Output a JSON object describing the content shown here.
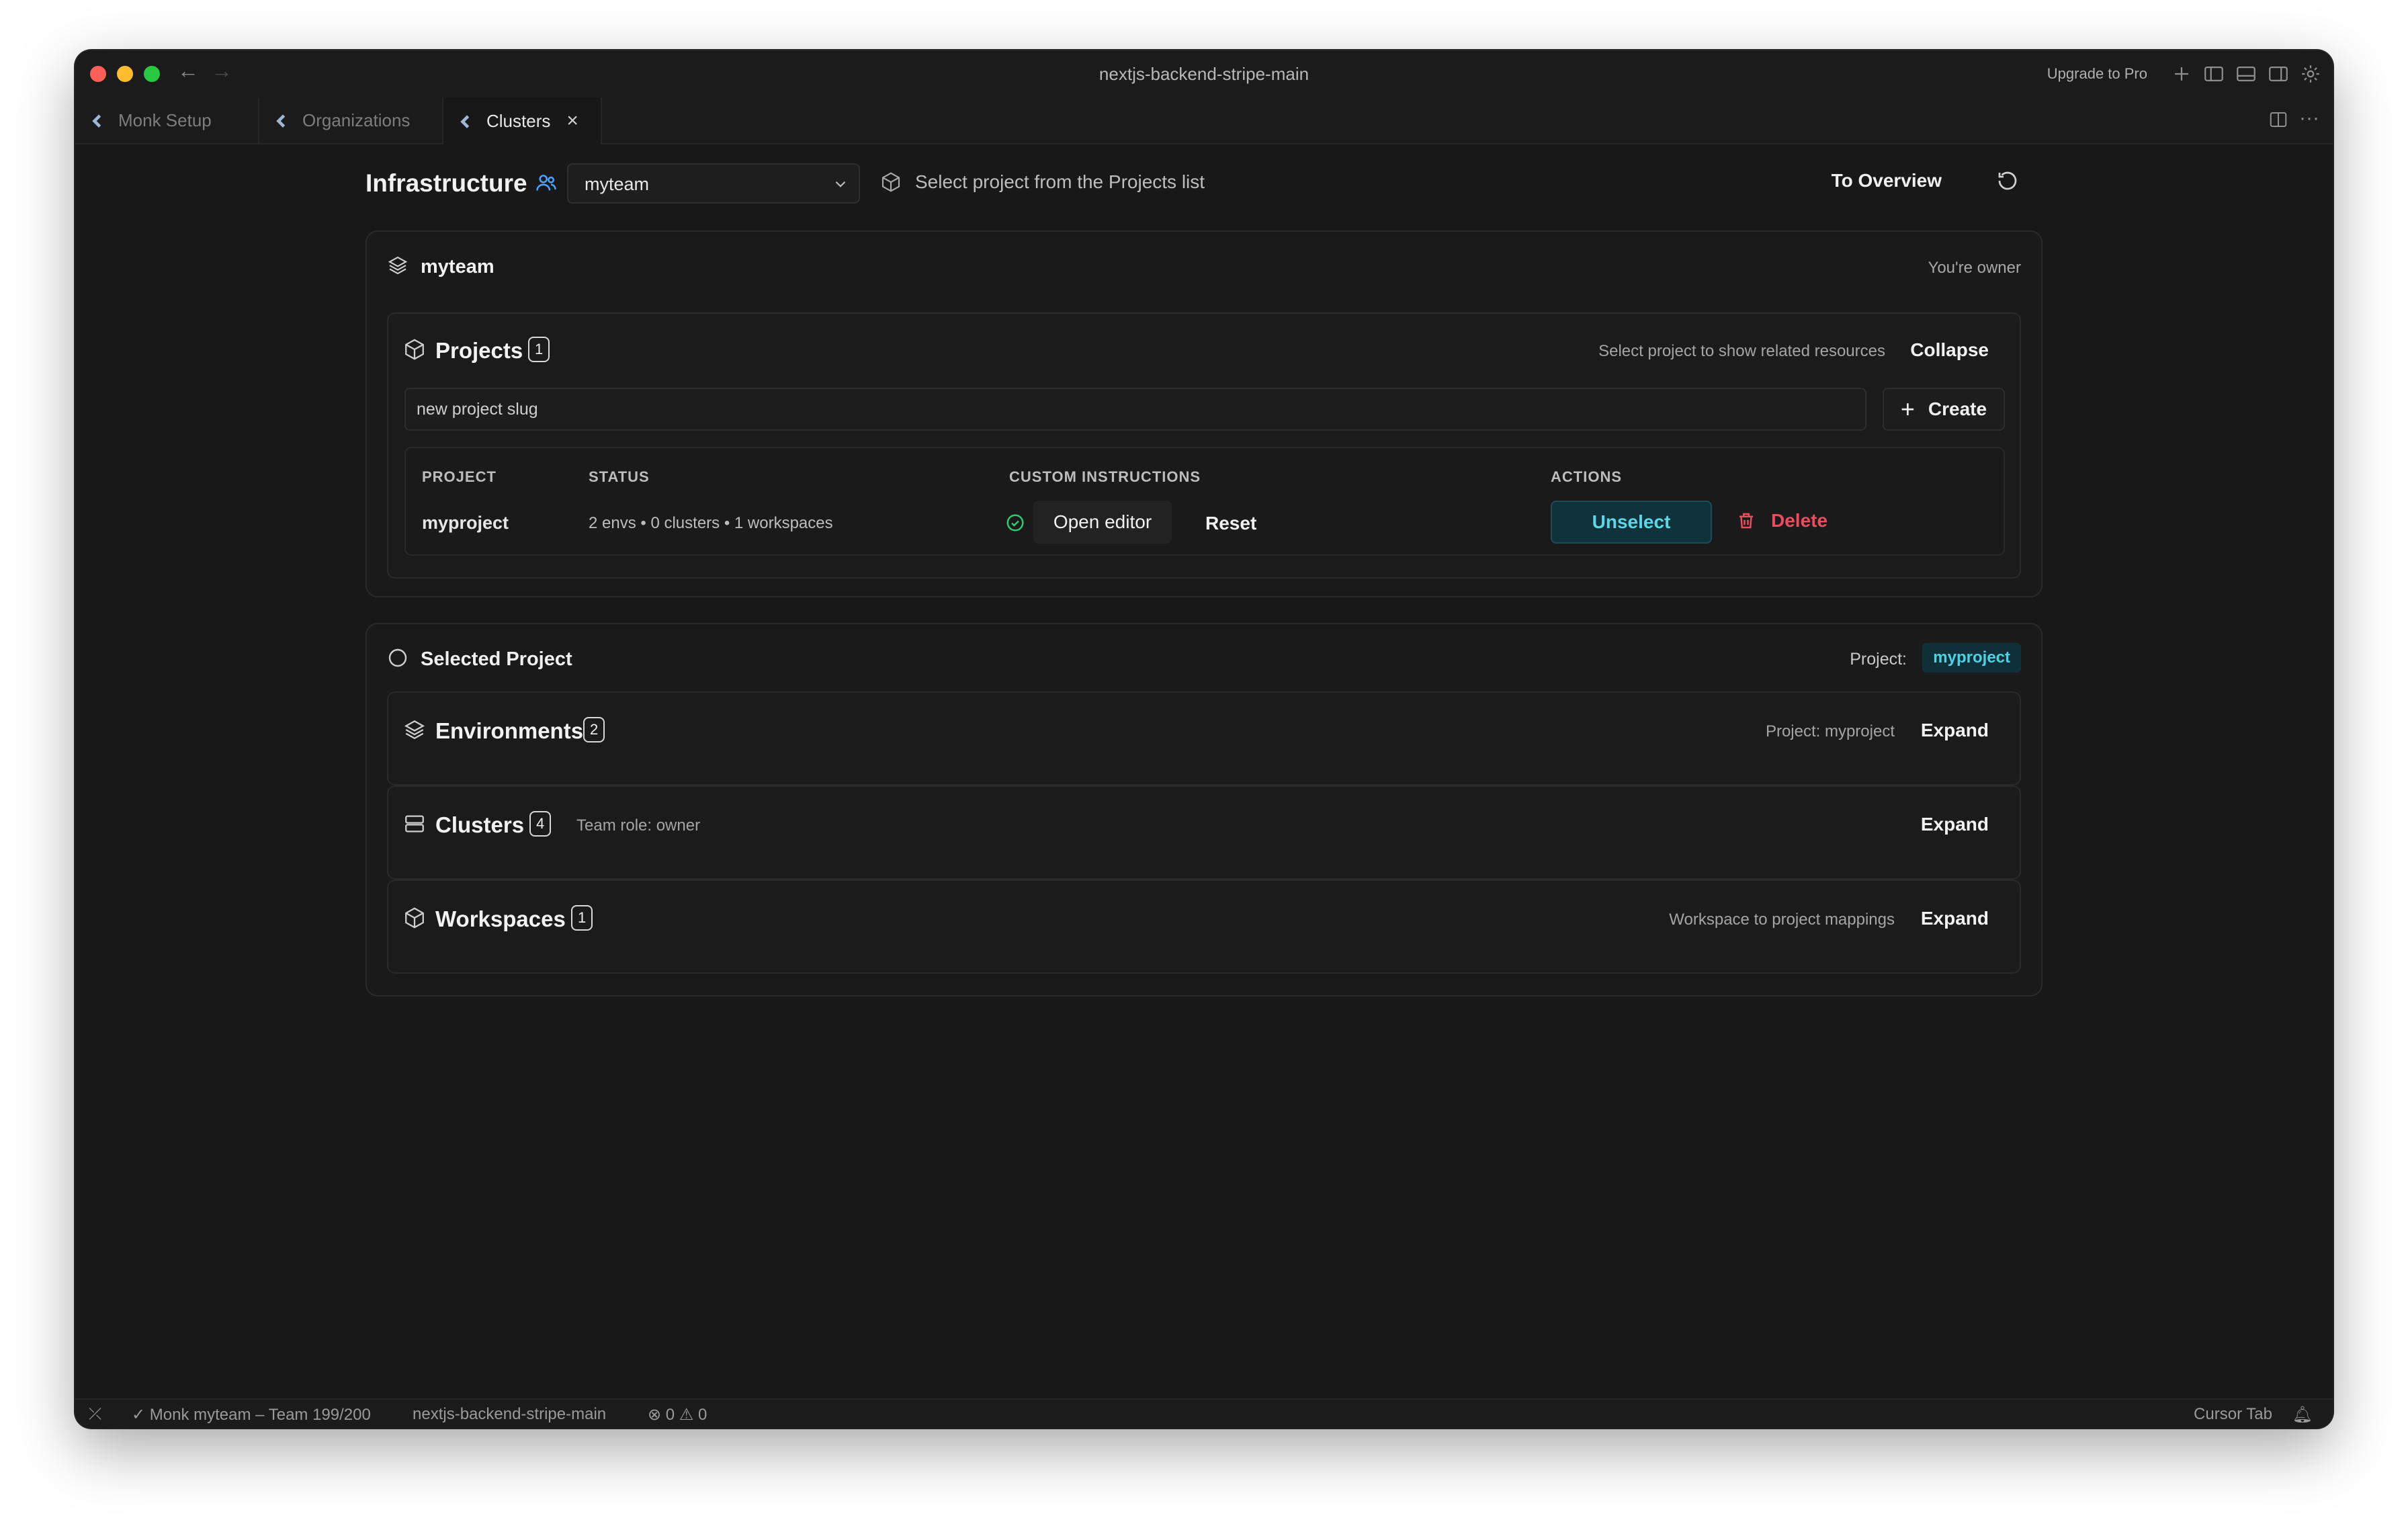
{
  "window": {
    "title": "nextjs-backend-stripe-main",
    "upgrade_label": "Upgrade to Pro"
  },
  "tabs": [
    {
      "label": "Monk Setup",
      "active": false
    },
    {
      "label": "Organizations",
      "active": false
    },
    {
      "label": "Clusters",
      "active": true
    }
  ],
  "header": {
    "title": "Infrastructure",
    "team_select": "myteam",
    "project_hint": "Select project from the Projects list",
    "to_overview": "To Overview"
  },
  "team_card": {
    "name": "myteam",
    "role_note": "You're owner",
    "projects": {
      "title": "Projects",
      "count": "1",
      "hint": "Select project to show related resources",
      "collapse_label": "Collapse",
      "new_slug_placeholder": "new project slug",
      "create_label": "Create",
      "columns": [
        "PROJECT",
        "STATUS",
        "CUSTOM INSTRUCTIONS",
        "ACTIONS"
      ],
      "rows": [
        {
          "project": "myproject",
          "status": "2 envs • 0 clusters • 1 workspaces",
          "open_editor": "Open editor",
          "reset": "Reset",
          "unselect": "Unselect",
          "delete": "Delete"
        }
      ]
    }
  },
  "selected_card": {
    "title": "Selected Project",
    "project_label": "Project:",
    "project_value": "myproject",
    "sections": {
      "environments": {
        "title": "Environments",
        "count": "2",
        "note": "Project: myproject",
        "action": "Expand"
      },
      "clusters": {
        "title": "Clusters",
        "count": "4",
        "note": "Team role: owner",
        "action": "Expand"
      },
      "workspaces": {
        "title": "Workspaces",
        "count": "1",
        "note": "Workspace to project mappings",
        "action": "Expand"
      }
    }
  },
  "statusbar": {
    "account": "Monk myteam – Team 199/200",
    "repo": "nextjs-backend-stripe-main",
    "errors": "0",
    "warnings": "0",
    "cursor_tab": "Cursor Tab"
  },
  "colors": {
    "accent_cyan": "#4fd1e4",
    "danger": "#f04a5e",
    "success": "#2ecc71",
    "team_icon": "#4aa3ff"
  }
}
